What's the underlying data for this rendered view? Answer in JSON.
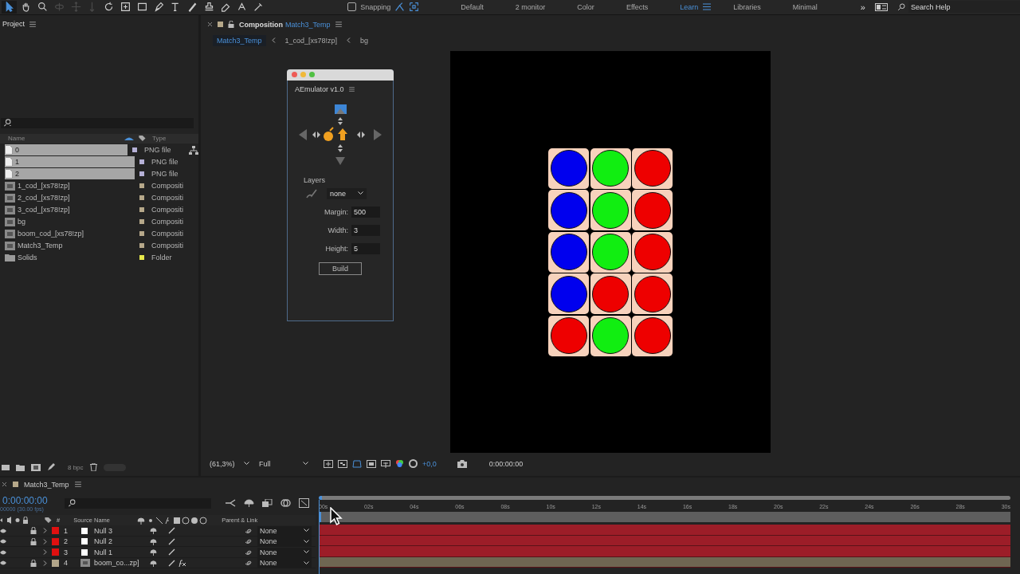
{
  "toolbar": {
    "tools": [
      {
        "kind": "select",
        "selected": true,
        "disabled": false
      },
      {
        "kind": "hand",
        "selected": false,
        "disabled": false
      },
      {
        "kind": "zoom",
        "selected": false,
        "disabled": false
      },
      {
        "kind": "orbit",
        "selected": false,
        "disabled": true
      },
      {
        "kind": "pan",
        "selected": false,
        "disabled": true
      },
      {
        "kind": "dolly",
        "selected": false,
        "disabled": true
      },
      {
        "kind": "rotate",
        "selected": false,
        "disabled": false
      },
      {
        "kind": "anchor",
        "selected": false,
        "disabled": false
      },
      {
        "kind": "rect",
        "selected": false,
        "disabled": false
      },
      {
        "kind": "pen",
        "selected": false,
        "disabled": false
      },
      {
        "kind": "type",
        "selected": false,
        "disabled": false
      },
      {
        "kind": "brush",
        "selected": false,
        "disabled": false
      },
      {
        "kind": "stamp",
        "selected": false,
        "disabled": false
      },
      {
        "kind": "eraser",
        "selected": false,
        "disabled": false
      },
      {
        "kind": "roto",
        "selected": false,
        "disabled": false
      },
      {
        "kind": "puppet",
        "selected": false,
        "disabled": false
      }
    ],
    "snapping": {
      "label": "Snapping",
      "checked": false
    },
    "workspaces": [
      {
        "label": "Default",
        "selected": false
      },
      {
        "label": "2 monitor",
        "selected": false
      },
      {
        "label": "Color",
        "selected": false
      },
      {
        "label": "Effects",
        "selected": false
      },
      {
        "label": "Learn",
        "selected": true
      },
      {
        "label": "Libraries",
        "selected": false
      },
      {
        "label": "Minimal",
        "selected": false
      }
    ],
    "overflow": "»",
    "search": {
      "placeholder": "Search Help"
    }
  },
  "project": {
    "title": "Project",
    "columns": [
      "Name",
      "Type"
    ],
    "items": [
      {
        "name": "0",
        "type": "PNG file",
        "kind": "image",
        "color": "#b5b0d6",
        "selected": true
      },
      {
        "name": "1",
        "type": "PNG file",
        "kind": "image",
        "color": "#b5b0d6",
        "selected": true
      },
      {
        "name": "2",
        "type": "PNG file",
        "kind": "image",
        "color": "#b5b0d6",
        "selected": true
      },
      {
        "name": "1_cod_[xs78!zp]",
        "type": "Compositi",
        "kind": "comp",
        "color": "#b6a88a",
        "selected": false
      },
      {
        "name": "2_cod_[xs78!zp]",
        "type": "Compositi",
        "kind": "comp",
        "color": "#b6a88a",
        "selected": false
      },
      {
        "name": "3_cod_[xs78!zp]",
        "type": "Compositi",
        "kind": "comp",
        "color": "#b6a88a",
        "selected": false
      },
      {
        "name": "bg",
        "type": "Compositi",
        "kind": "comp",
        "color": "#b6a88a",
        "selected": false
      },
      {
        "name": "boom_cod_[xs78!zp]",
        "type": "Compositi",
        "kind": "comp",
        "color": "#b6a88a",
        "selected": false
      },
      {
        "name": "Match3_Temp",
        "type": "Compositi",
        "kind": "comp",
        "color": "#b6a88a",
        "selected": false
      },
      {
        "name": "Solids",
        "type": "Folder",
        "kind": "folder",
        "color": "#e6e84a",
        "selected": false
      }
    ],
    "bit_depth": "8 bpc"
  },
  "composition": {
    "tab_label": "Composition",
    "tab_name": "Match3_Temp",
    "breadcrumbs": [
      {
        "label": "Match3_Temp",
        "selected": true
      },
      {
        "label": "1_cod_[xs78!zp]",
        "selected": false
      },
      {
        "label": "bg",
        "selected": false
      }
    ],
    "board": [
      [
        {
          "color": "#0000ee"
        },
        {
          "color": "#11ee11"
        },
        {
          "color": "#ee0000"
        }
      ],
      [
        {
          "color": "#0000ee"
        },
        {
          "color": "#11ee11"
        },
        {
          "color": "#ee0000"
        }
      ],
      [
        {
          "color": "#0000ee"
        },
        {
          "color": "#11ee11"
        },
        {
          "color": "#ee0000"
        }
      ],
      [
        {
          "color": "#0000ee"
        },
        {
          "color": "#ee0000"
        },
        {
          "color": "#ee0000"
        }
      ],
      [
        {
          "color": "#ee0000"
        },
        {
          "color": "#11ee11"
        },
        {
          "color": "#ee0000"
        }
      ]
    ],
    "zoom": "(61,3%)",
    "resolution": "Full",
    "exposure": "+0,0",
    "timecode": "0:00:00:00"
  },
  "plugin": {
    "title": "AEmulator v1.0",
    "layers_label": "Layers",
    "layers_value": "none",
    "fields": [
      {
        "label": "Margin:",
        "value": "500"
      },
      {
        "label": "Width:",
        "value": "3"
      },
      {
        "label": "Height:",
        "value": "5"
      }
    ],
    "button": "Build"
  },
  "timeline": {
    "tab": "Match3_Temp",
    "timecode": "0:00:00:00",
    "frame_info": "00000 (30.00 fps)",
    "columns": {
      "number": "#",
      "source": "Source Name",
      "parent": "Parent & Link"
    },
    "ruler": [
      "00s",
      "02s",
      "04s",
      "06s",
      "08s",
      "10s",
      "12s",
      "14s",
      "16s",
      "18s",
      "20s",
      "22s",
      "24s",
      "26s",
      "28s",
      "30s"
    ],
    "layers": [
      {
        "number": "1",
        "name": "Null 3",
        "kind": "null",
        "color": "#e01010",
        "locked": true,
        "fx": false,
        "parent": "None"
      },
      {
        "number": "2",
        "name": "Null 2",
        "kind": "null",
        "color": "#e01010",
        "locked": true,
        "fx": false,
        "parent": "None"
      },
      {
        "number": "3",
        "name": "Null 1",
        "kind": "null",
        "color": "#e01010",
        "locked": false,
        "fx": false,
        "parent": "None"
      },
      {
        "number": "4",
        "name": "boom_co...zp]",
        "kind": "comp",
        "color": "#b3a68a",
        "locked": true,
        "fx": true,
        "parent": "None"
      }
    ]
  }
}
